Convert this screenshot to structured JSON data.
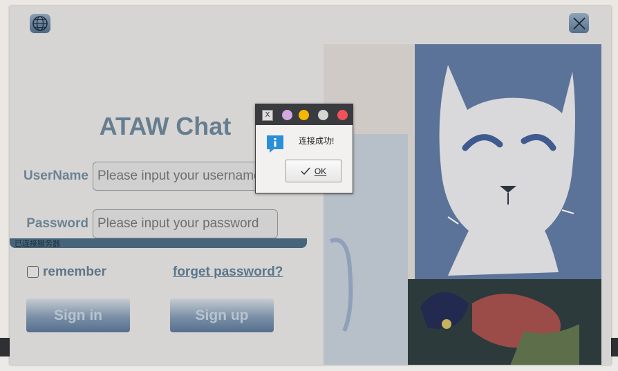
{
  "app": {
    "title": "ATAW Chat",
    "username_label": "UserName",
    "username_placeholder": "Please input your username",
    "password_label": "Password",
    "password_placeholder": "Please input your password",
    "status_text": "已连接服务器",
    "remember_label": "remember",
    "remember_checked": false,
    "forget_label": "forget password?",
    "signin_label": "Sign in",
    "signup_label": "Sign up"
  },
  "icons": {
    "globe": "globe-icon",
    "close": "close-icon",
    "info": "info-icon",
    "check": "check-icon"
  },
  "dialog": {
    "message": "连接成功!",
    "ok_label": "OK",
    "app_icon_text": "X"
  },
  "colors": {
    "title_text": "#657e90",
    "status_bar": "#46657a",
    "dot_purple": "#d3a8de",
    "dot_yellow": "#f5b800",
    "dot_gray": "#d5d5d5",
    "dot_red": "#f0525a",
    "info_blue": "#2a8fd8"
  }
}
